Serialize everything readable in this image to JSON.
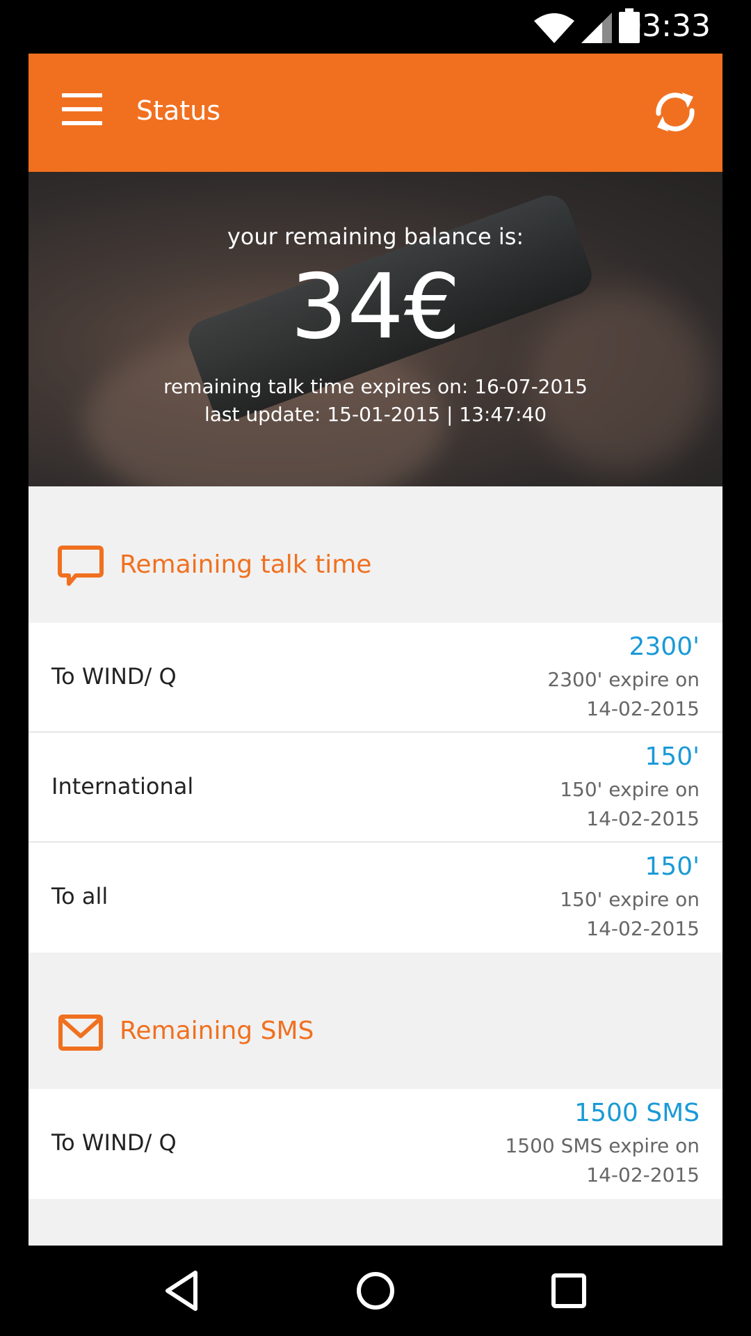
{
  "status_bar": {
    "time": "03:33",
    "icons": [
      "wifi-icon",
      "cell-signal-icon",
      "battery-icon"
    ]
  },
  "toolbar": {
    "title": "Status",
    "menu_icon": "hamburger-menu-icon",
    "refresh_icon": "refresh-icon"
  },
  "hero": {
    "label": "your remaining balance is:",
    "balance": "34€",
    "expires": "remaining talk time expires on: 16-07-2015",
    "last_update": "last update: 15-01-2015 | 13:47:40"
  },
  "talk_time": {
    "title": "Remaining talk time",
    "icon": "chat-bubble-icon",
    "rows": [
      {
        "label": "To WIND/ Q",
        "value": "2300'",
        "sub1": "2300' expire on",
        "sub2": "14-02-2015"
      },
      {
        "label": "International",
        "value": "150'",
        "sub1": "150' expire on",
        "sub2": "14-02-2015"
      },
      {
        "label": "To all",
        "value": "150'",
        "sub1": "150' expire on",
        "sub2": "14-02-2015"
      }
    ]
  },
  "sms": {
    "title": "Remaining SMS",
    "icon": "envelope-icon",
    "rows": [
      {
        "label": "To WIND/ Q",
        "value": "1500 SMS",
        "sub1": "1500 SMS expire on",
        "sub2": "14-02-2015"
      }
    ]
  },
  "nav_bar": {
    "icons": [
      "back-icon",
      "home-icon",
      "recents-icon"
    ]
  },
  "colors": {
    "accent": "#f07020",
    "value_blue": "#1a9ad6",
    "background": "#f1f1f1"
  }
}
